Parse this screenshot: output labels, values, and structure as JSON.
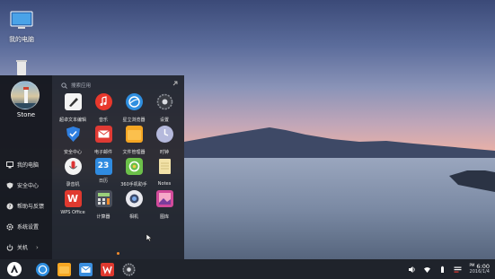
{
  "desktop": {
    "icons": [
      {
        "label": "我的电脑",
        "icon": "computer-icon"
      },
      {
        "label": "",
        "icon": "trash-icon"
      }
    ]
  },
  "start_menu": {
    "user": {
      "name": "Stone"
    },
    "side_items": [
      {
        "label": "我的电脑",
        "icon": "computer-icon"
      },
      {
        "label": "安全中心",
        "icon": "shield-icon"
      },
      {
        "label": "帮助与反馈",
        "icon": "help-icon"
      },
      {
        "label": "系统设置",
        "icon": "gear-icon"
      },
      {
        "label": "关机",
        "icon": "power-icon",
        "has_arrow": true
      }
    ],
    "search_placeholder": "搜索应用",
    "apps": [
      {
        "label": "超卓文本编辑",
        "color": "#f4f4f4",
        "icon": "text-editor-icon"
      },
      {
        "label": "音乐",
        "color": "#e8382c",
        "icon": "music-icon"
      },
      {
        "label": "星立浏览器",
        "color": "#2f8fe0",
        "icon": "browser-icon"
      },
      {
        "label": "设置",
        "color": "#3a3d44",
        "icon": "gear-icon"
      },
      {
        "label": "安全中心",
        "color": "#2f7fe0",
        "icon": "shield-icon"
      },
      {
        "label": "电子邮件",
        "color": "#e03a34",
        "icon": "mail-icon"
      },
      {
        "label": "文件管理器",
        "color": "#f5a623",
        "icon": "folder-icon"
      },
      {
        "label": "时钟",
        "color": "#b5b9dc",
        "icon": "clock-icon"
      },
      {
        "label": "录音机",
        "color": "#f3f3f3",
        "icon": "recorder-icon"
      },
      {
        "label": "日历",
        "color": "#2f8be0",
        "icon": "calendar-icon",
        "badge": "23"
      },
      {
        "label": "360手机助手",
        "color": "#6cc04a",
        "icon": "assistant-icon"
      },
      {
        "label": "Notes",
        "color": "#f2e2a8",
        "icon": "notes-icon"
      },
      {
        "label": "WPS Office",
        "color": "#e0392f",
        "icon": "wps-icon",
        "badge": "W"
      },
      {
        "label": "计算器",
        "color": "#4a4f5a",
        "icon": "calculator-icon"
      },
      {
        "label": "相机",
        "color": "#e8e8ee",
        "icon": "camera-icon"
      },
      {
        "label": "图库",
        "color": "#d14a9a",
        "icon": "gallery-icon"
      }
    ]
  },
  "taskbar": {
    "apps": [
      {
        "icon": "browser-icon",
        "color": "#2f8fe0"
      },
      {
        "icon": "folder-icon",
        "color": "#f5a623"
      },
      {
        "icon": "mail-icon",
        "color": "#3b8fe0"
      },
      {
        "icon": "wps-icon",
        "color": "#e0392f"
      },
      {
        "icon": "gear-icon",
        "color": "#3a3d44"
      }
    ],
    "tray": {
      "time": "6:00",
      "ampm": "PM",
      "date": "2016/1/4"
    }
  },
  "colors": {
    "accent": "#f28c2c",
    "menu_bg": "#20242c",
    "taskbar_bg": "#1f232b"
  }
}
